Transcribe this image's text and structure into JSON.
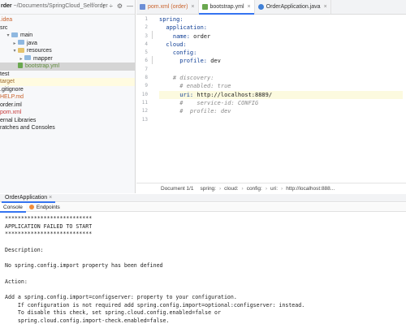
{
  "project": {
    "header_name": "rder",
    "header_path": "~/Documents/SpringCloud_Self/order",
    "tool_icons": [
      "↕",
      "÷",
      "⚙",
      "—"
    ],
    "tree": [
      {
        "label": ".idea",
        "color": "orange"
      },
      {
        "label": "src",
        "color": "default"
      },
      {
        "label": "main",
        "color": "default",
        "arrow": "▾",
        "folder": true
      },
      {
        "label": "java",
        "color": "default",
        "arrow": "▸",
        "folder": true
      },
      {
        "label": "resources",
        "color": "default",
        "arrow": "▾",
        "folder": true,
        "res": true
      },
      {
        "label": "mapper",
        "color": "default",
        "arrow": "▸",
        "folder": true
      },
      {
        "label": "bootstrap.yml",
        "color": "green",
        "file": "yml",
        "selected": true
      },
      {
        "label": "test",
        "color": "default"
      },
      {
        "label": "target",
        "color": "brown",
        "highlight": true
      },
      {
        "label": ".gitignore",
        "color": "default"
      },
      {
        "label": "HELP.md",
        "color": "orange"
      },
      {
        "label": "order.iml",
        "color": "default"
      },
      {
        "label": "pom.xml",
        "color": "red"
      },
      {
        "label": "ernal Libraries",
        "color": "default"
      },
      {
        "label": "ratches and Consoles",
        "color": "default"
      }
    ]
  },
  "editor": {
    "tabs": [
      {
        "label": "pom.xml (order)",
        "icon": "m",
        "active": false
      },
      {
        "label": "bootstrap.yml",
        "icon": "y",
        "active": true
      },
      {
        "label": "OrderApplication.java",
        "icon": "j",
        "active": false
      }
    ],
    "close_glyph": "×",
    "line_numbers": [
      "1",
      "2",
      "3",
      "4",
      "5",
      "6",
      "7",
      "8",
      "9",
      "10",
      "11",
      "12",
      "13"
    ],
    "lines": [
      [
        {
          "t": "spring:",
          "c": "k"
        }
      ],
      [
        {
          "t": "  application:",
          "c": "k"
        }
      ],
      [
        {
          "t": "    name: ",
          "c": "k"
        },
        {
          "t": "order",
          "c": "v"
        }
      ],
      [
        {
          "t": "  cloud:",
          "c": "k"
        }
      ],
      [
        {
          "t": "    config:",
          "c": "k"
        }
      ],
      [
        {
          "t": "      profile: ",
          "c": "k"
        },
        {
          "t": "dev",
          "c": "v"
        }
      ],
      [
        {
          "t": "",
          "c": "v"
        }
      ],
      [
        {
          "t": "    # discovery:",
          "c": "c"
        }
      ],
      [
        {
          "t": "      # enabled: true",
          "c": "c"
        }
      ],
      [
        {
          "t": "      uri: ",
          "c": "k"
        },
        {
          "t": "http://localhost:8889/",
          "c": "v"
        }
      ],
      [
        {
          "t": "      #    service-id: CONFIG",
          "c": "c"
        }
      ],
      [
        {
          "t": "      #  profile: dev",
          "c": "c"
        }
      ],
      [
        {
          "t": "",
          "c": "v"
        }
      ]
    ],
    "current_line": 9,
    "breadcrumb": [
      "Document 1/1",
      "spring:",
      "cloud:",
      "config:",
      "uri:",
      "http://localhost:888..."
    ]
  },
  "run": {
    "tab_label": "OrderApplication",
    "sub_tabs": [
      "Console",
      "Endpoints"
    ],
    "console_lines": [
      "***************************",
      "APPLICATION FAILED TO START",
      "***************************",
      "",
      "Description:",
      "",
      "No spring.config.import property has been defined",
      "",
      "Action:",
      "",
      "Add a spring.config.import=configserver: property to your configuration.",
      "    If configuration is not required add spring.config.import=optional:configserver: instead.",
      "    To disable this check, set spring.cloud.config.enabled=false or",
      "    spring.cloud.config.import-check.enabled=false."
    ]
  }
}
